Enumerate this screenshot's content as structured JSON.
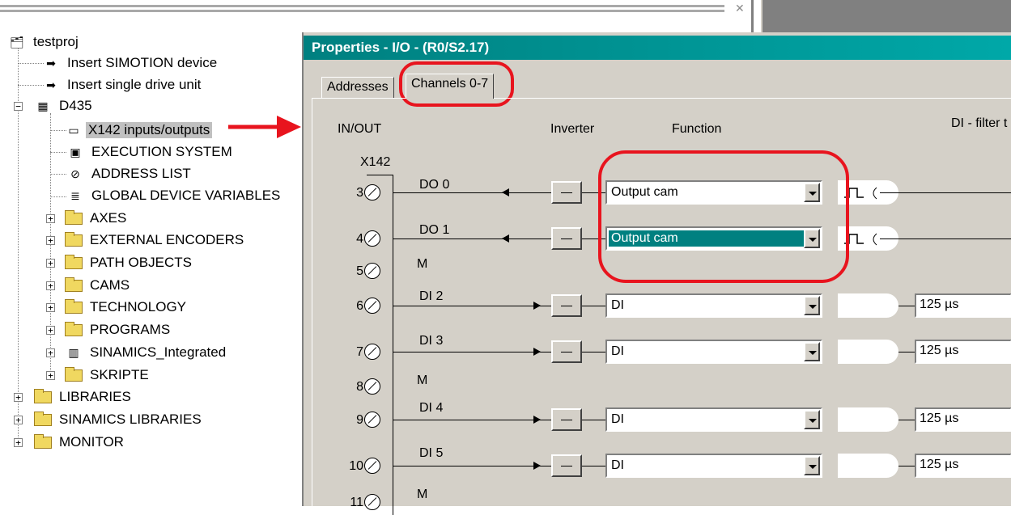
{
  "tree": {
    "root": "testproj",
    "items": [
      {
        "label": "Insert SIMOTION device"
      },
      {
        "label": "Insert single drive unit"
      },
      {
        "label": "D435"
      },
      {
        "label": "X142 inputs/outputs"
      },
      {
        "label": "EXECUTION SYSTEM"
      },
      {
        "label": "ADDRESS LIST"
      },
      {
        "label": "GLOBAL DEVICE VARIABLES"
      },
      {
        "label": "AXES"
      },
      {
        "label": "EXTERNAL ENCODERS"
      },
      {
        "label": "PATH OBJECTS"
      },
      {
        "label": "CAMS"
      },
      {
        "label": "TECHNOLOGY"
      },
      {
        "label": "PROGRAMS"
      },
      {
        "label": "SINAMICS_Integrated"
      },
      {
        "label": "SKRIPTE"
      },
      {
        "label": "LIBRARIES"
      },
      {
        "label": "SINAMICS LIBRARIES"
      },
      {
        "label": "MONITOR"
      }
    ]
  },
  "props": {
    "title": "Properties - I/O - (R0/S2.17)",
    "tabs": [
      "Addresses",
      "Channels 0-7"
    ],
    "headers": {
      "inout": "IN/OUT",
      "inverter": "Inverter",
      "function": "Function",
      "filter": "DI - filter t"
    },
    "connector": "X142",
    "pins": [
      "3",
      "4",
      "5",
      "6",
      "7",
      "8",
      "9",
      "10",
      "11"
    ],
    "m_label": "M",
    "channels": [
      {
        "name": "DO 0",
        "function": "Output cam"
      },
      {
        "name": "DO 1",
        "function": "Output cam"
      },
      {
        "name": "DI 2",
        "function": "DI",
        "filter": "125 µs"
      },
      {
        "name": "DI 3",
        "function": "DI",
        "filter": "125 µs"
      },
      {
        "name": "DI 4",
        "function": "DI",
        "filter": "125 µs"
      },
      {
        "name": "DI 5",
        "function": "DI",
        "filter": "125 µs"
      }
    ]
  },
  "colors": {
    "title_bar": "#008080",
    "annotation": "#e8141e",
    "selection": "#008080"
  }
}
